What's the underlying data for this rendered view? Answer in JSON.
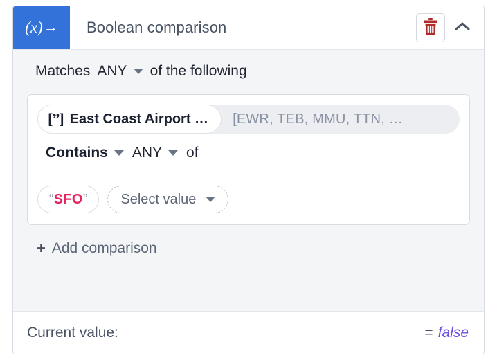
{
  "header": {
    "icon_label": "(x)",
    "icon_arrow": "→",
    "icon_name": "expression-node-icon",
    "title": "Boolean comparison",
    "delete_icon": "trash-icon",
    "collapse_icon": "chevron-up-icon",
    "delete_color": "#b12a2a",
    "icon_background": "#3272d9"
  },
  "matches": {
    "prefix": "Matches",
    "mode": "ANY",
    "suffix": "of the following"
  },
  "comparison": {
    "field": {
      "icon": "quote-bracket-icon",
      "icon_glyph": "[”]",
      "label": "East Coast Airport …",
      "value_preview": "[EWR, TEB, MMU, TTN, …"
    },
    "operator": {
      "operator": "Contains",
      "quantifier": "ANY",
      "connector": "of"
    },
    "operands": [
      {
        "type": "literal",
        "open_quote": "“",
        "value": "SFO",
        "close_quote": "”",
        "value_color": "#e8245f"
      },
      {
        "type": "select",
        "placeholder": "Select value"
      }
    ]
  },
  "add_comparison": {
    "plus": "+",
    "label": "Add comparison"
  },
  "footer": {
    "label": "Current value:",
    "equals": "=",
    "result": "false",
    "result_color": "#6b4fe0"
  }
}
